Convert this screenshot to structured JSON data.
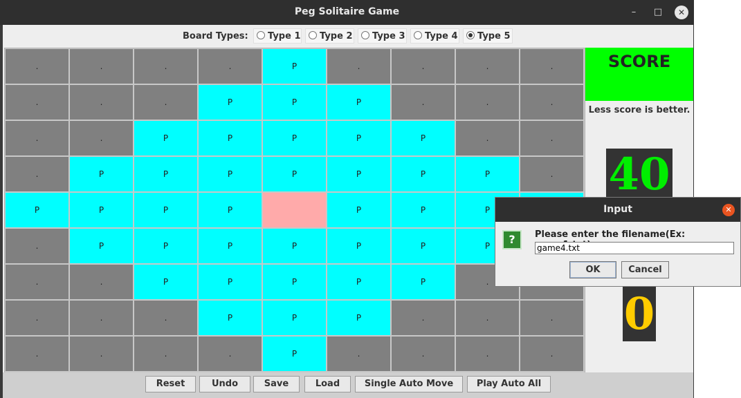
{
  "window": {
    "title": "Peg Solitaire Game",
    "minimize_glyph": "–",
    "maximize_glyph": "□",
    "close_glyph": "✕"
  },
  "board_types": {
    "label": "Board Types:",
    "options": [
      {
        "label": "Type 1",
        "selected": false
      },
      {
        "label": "Type 2",
        "selected": false
      },
      {
        "label": "Type 3",
        "selected": false
      },
      {
        "label": "Type 4",
        "selected": false
      },
      {
        "label": "Type 5",
        "selected": true
      }
    ]
  },
  "board": {
    "peg_symbol": "P",
    "invalid_symbol": ".",
    "rows": [
      "....P....",
      "...PPP...",
      "..PPPPP..",
      ".PPPPPPP.",
      "PPPPEPPPP",
      ".PPPPPPP.",
      "..PPPPP..",
      "...PPP...",
      "....P...."
    ],
    "colors": {
      "peg": "#00ffff",
      "invalid": "#808080",
      "empty": "#ffaaaa"
    }
  },
  "score": {
    "title": "SCORE",
    "note": "Less score is better.",
    "value": "40",
    "second_value": "0",
    "header_color": "#00ff00"
  },
  "buttons": {
    "reset": "Reset",
    "undo": "Undo",
    "save": "Save",
    "load": "Load",
    "single_auto": "Single Auto Move",
    "play_auto_all": "Play Auto All"
  },
  "dialog": {
    "title": "Input",
    "message": "Please enter the filename(Ex: game1.txt)",
    "input_value": "game4.txt",
    "ok": "OK",
    "cancel": "Cancel",
    "icon_glyph": "?",
    "close_glyph": "✕"
  }
}
